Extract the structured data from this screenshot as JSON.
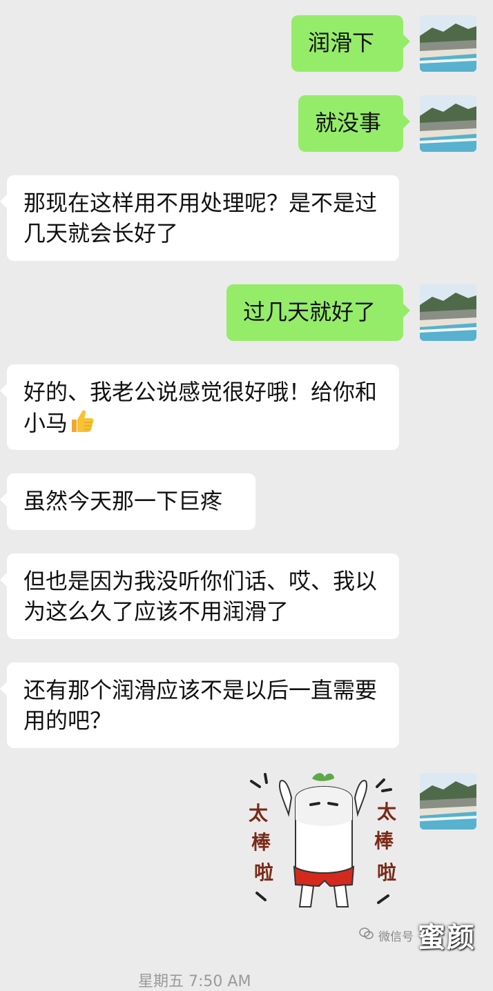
{
  "messages": [
    {
      "side": "sent",
      "text": "润滑下"
    },
    {
      "side": "sent",
      "text": "就没事"
    },
    {
      "side": "recv",
      "text": "那现在这样用不用处理呢？是不是过几天就会长好了"
    },
    {
      "side": "sent",
      "text": "过几天就好了"
    },
    {
      "side": "recv",
      "text": "好的、我老公说感觉很好哦！给你和小马",
      "emoji": "thumbs-up-emoji"
    },
    {
      "side": "recv",
      "text": "虽然今天那一下巨疼"
    },
    {
      "side": "recv",
      "text": "但也是因为我没听你们话、哎、我以为这么久了应该不用润滑了"
    },
    {
      "side": "recv",
      "text": "还有那个润滑应该不是以后一直需要用的吧？"
    },
    {
      "side": "sent",
      "sticker": "radish-cheer-sticker"
    }
  ],
  "sticker": {
    "left_text": "太棒啦",
    "right_text": "太棒啦"
  },
  "watermark": {
    "label": "微信号",
    "brand": "蜜颜"
  },
  "footer": {
    "time": "星期五 7:50 AM"
  },
  "colors": {
    "sent_bubble": "#95ec69",
    "recv_bubble": "#ffffff",
    "background": "#ebebeb"
  }
}
